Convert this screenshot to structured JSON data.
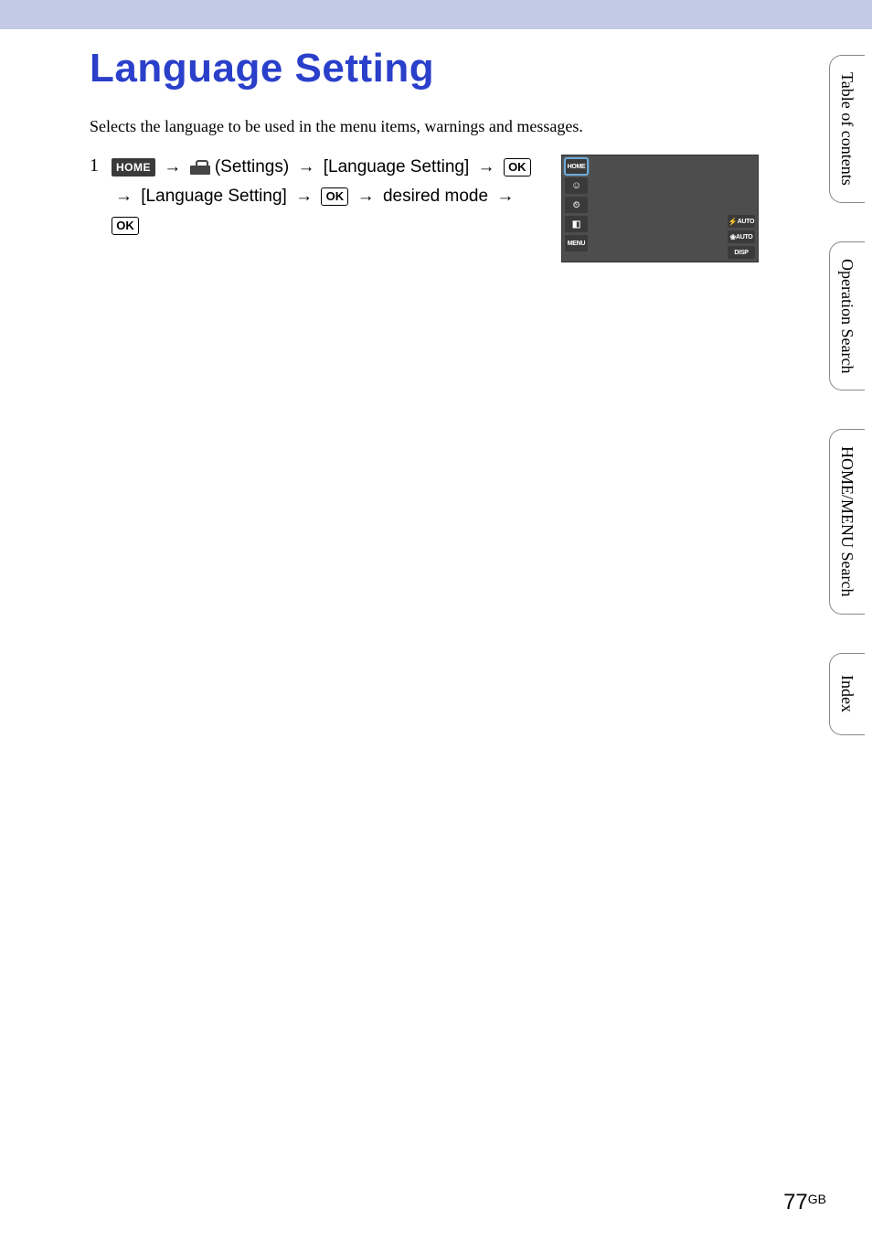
{
  "page": {
    "title": "Language Setting",
    "intro": "Selects the language to be used in the menu items, warnings and messages.",
    "number": "77",
    "region": "GB"
  },
  "step": {
    "num": "1",
    "home_label": "HOME",
    "settings_label": "(Settings)",
    "menu_item_1": "[Language Setting]",
    "ok_label": "OK",
    "menu_item_2": "[Language Setting]",
    "desired": "desired mode"
  },
  "arrows": {
    "right": "→"
  },
  "camera": {
    "left_buttons": [
      "HOME",
      "",
      "",
      "",
      "MENU"
    ],
    "right_buttons": [
      "AUTO",
      "AUTO",
      "DISP"
    ],
    "left_icons": {
      "1": "smiley",
      "2": "timer",
      "3": "scene"
    }
  },
  "side_tabs": [
    "Table of contents",
    "Operation Search",
    "HOME/MENU Search",
    "Index"
  ]
}
